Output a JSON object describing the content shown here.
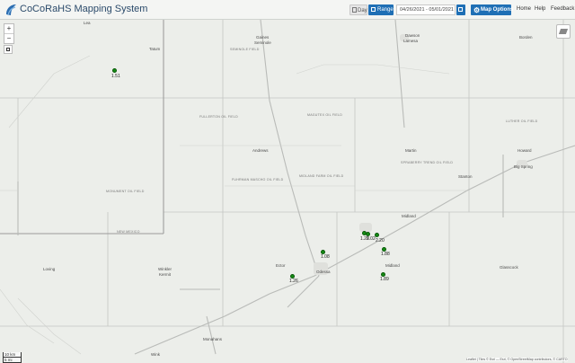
{
  "app": {
    "title": "CoCoRaHS Mapping System"
  },
  "toolbar": {
    "day_label": "Day",
    "range_label": "Range",
    "date_range": "04/26/2021 - 05/01/2021",
    "map_options_label": "Map Options",
    "nav": [
      "Home",
      "Help",
      "Feedback"
    ]
  },
  "map": {
    "zoom_in": "+",
    "zoom_out": "−",
    "scale_km": "10 km",
    "scale_mi": "5 mi",
    "attribution": "Leaflet | Tiles © Esri — Esri, © OpenStreetMap contributors, © CARTO",
    "places": [
      {
        "name": "Gaines",
        "cls": "place"
      },
      {
        "name": "Seminole",
        "cls": "place"
      },
      {
        "name": "Dawson",
        "cls": "place"
      },
      {
        "name": "Lamesa",
        "cls": "place"
      },
      {
        "name": "Borden",
        "cls": "place"
      },
      {
        "name": "Andrews",
        "cls": "place"
      },
      {
        "name": "Martin",
        "cls": "place"
      },
      {
        "name": "Howard",
        "cls": "place"
      },
      {
        "name": "Big Spring",
        "cls": "place"
      },
      {
        "name": "Midland",
        "cls": "place"
      },
      {
        "name": "Midland",
        "cls": "place"
      },
      {
        "name": "Ector",
        "cls": "place"
      },
      {
        "name": "Odessa",
        "cls": "place"
      },
      {
        "name": "Glasscock",
        "cls": "place"
      },
      {
        "name": "Winkler",
        "cls": "place"
      },
      {
        "name": "Kermit",
        "cls": "place"
      },
      {
        "name": "Loving",
        "cls": "place"
      },
      {
        "name": "Monahans",
        "cls": "place"
      },
      {
        "name": "Wink",
        "cls": "place"
      },
      {
        "name": "Lea",
        "cls": "place"
      },
      {
        "name": "SEMINOLE FIELD",
        "cls": "field"
      },
      {
        "name": "FULLERTON OIL FIELD",
        "cls": "field"
      },
      {
        "name": "MAGUTEX OIL FIELD",
        "cls": "field"
      },
      {
        "name": "FUHRMAN MASCHO OIL FIELD",
        "cls": "field"
      },
      {
        "name": "MIDLAND FARM OIL FIELD",
        "cls": "field"
      },
      {
        "name": "SPRABERRY TREND OIL FIELD",
        "cls": "field"
      },
      {
        "name": "LUTHER OIL FIELD",
        "cls": "field"
      },
      {
        "name": "MONUMENT OIL FIELD",
        "cls": "field"
      },
      {
        "name": "NEW MEXICO",
        "cls": "field"
      },
      {
        "name": "Stanton",
        "cls": "place"
      },
      {
        "name": "Tatum",
        "cls": "place"
      }
    ],
    "observations": [
      {
        "value": "1.51"
      },
      {
        "value": "1.28"
      },
      {
        "value": "2.02"
      },
      {
        "value": "2.20"
      },
      {
        "value": "1.88"
      },
      {
        "value": "1.89"
      },
      {
        "value": "1.08"
      },
      {
        "value": "1.26"
      }
    ]
  },
  "colors": {
    "marker": "#148b14",
    "toolbar_button": "#1f6fb5",
    "map_bg": "#eceeea"
  }
}
